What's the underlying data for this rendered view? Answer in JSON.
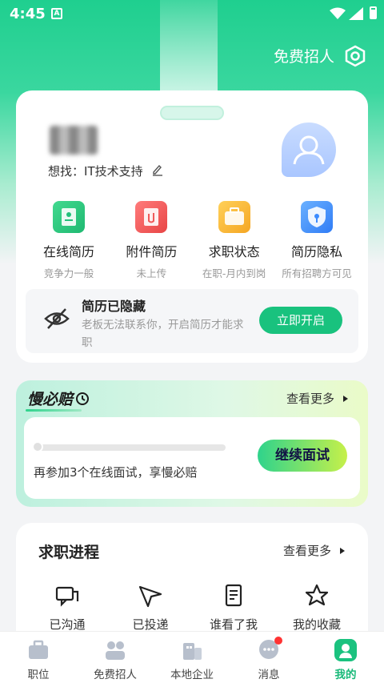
{
  "status_bar": {
    "time": "4:45",
    "notif_letter": "A"
  },
  "header": {
    "action_label": "免费招人"
  },
  "profile": {
    "seeking_label": "想找：",
    "seeking_value": "IT技术支持",
    "features": [
      {
        "title": "在线简历",
        "sub": "竞争力一般",
        "icon": "resume-icon",
        "color": "#22c07a"
      },
      {
        "title": "附件简历",
        "sub": "未上传",
        "icon": "attachment-icon",
        "color": "#f05a5a"
      },
      {
        "title": "求职状态",
        "sub": "在职-月内到岗",
        "icon": "briefcase-icon",
        "color": "#f5b324"
      },
      {
        "title": "简历隐私",
        "sub": "所有招聘方可见",
        "icon": "privacy-shield-icon",
        "color": "#3b8bff"
      }
    ],
    "hidden_notice": {
      "title": "简历已隐藏",
      "desc": "老板无法联系你，开启简历才能求职",
      "button": "立即开启"
    }
  },
  "slow_comp": {
    "title": "慢必赔",
    "more": "查看更多",
    "progress": 0.03,
    "text": "再参加3个在线面试，享慢必赔",
    "button": "继续面试"
  },
  "job_progress": {
    "title": "求职进程",
    "more": "查看更多",
    "items": [
      {
        "label": "已沟通",
        "icon": "chat-icon"
      },
      {
        "label": "已投递",
        "icon": "send-icon"
      },
      {
        "label": "谁看了我",
        "icon": "document-icon"
      },
      {
        "label": "我的收藏",
        "icon": "star-icon"
      }
    ]
  },
  "bottom_nav": [
    {
      "label": "职位",
      "icon": "briefcase-icon",
      "active": false
    },
    {
      "label": "免费招人",
      "icon": "recruit-icon",
      "active": false
    },
    {
      "label": "本地企业",
      "icon": "building-icon",
      "active": false
    },
    {
      "label": "消息",
      "icon": "message-icon",
      "active": false,
      "badge": true
    },
    {
      "label": "我的",
      "icon": "profile-icon",
      "active": true
    }
  ],
  "colors": {
    "brand": "#19c27e",
    "accent_active": "#17b978"
  }
}
